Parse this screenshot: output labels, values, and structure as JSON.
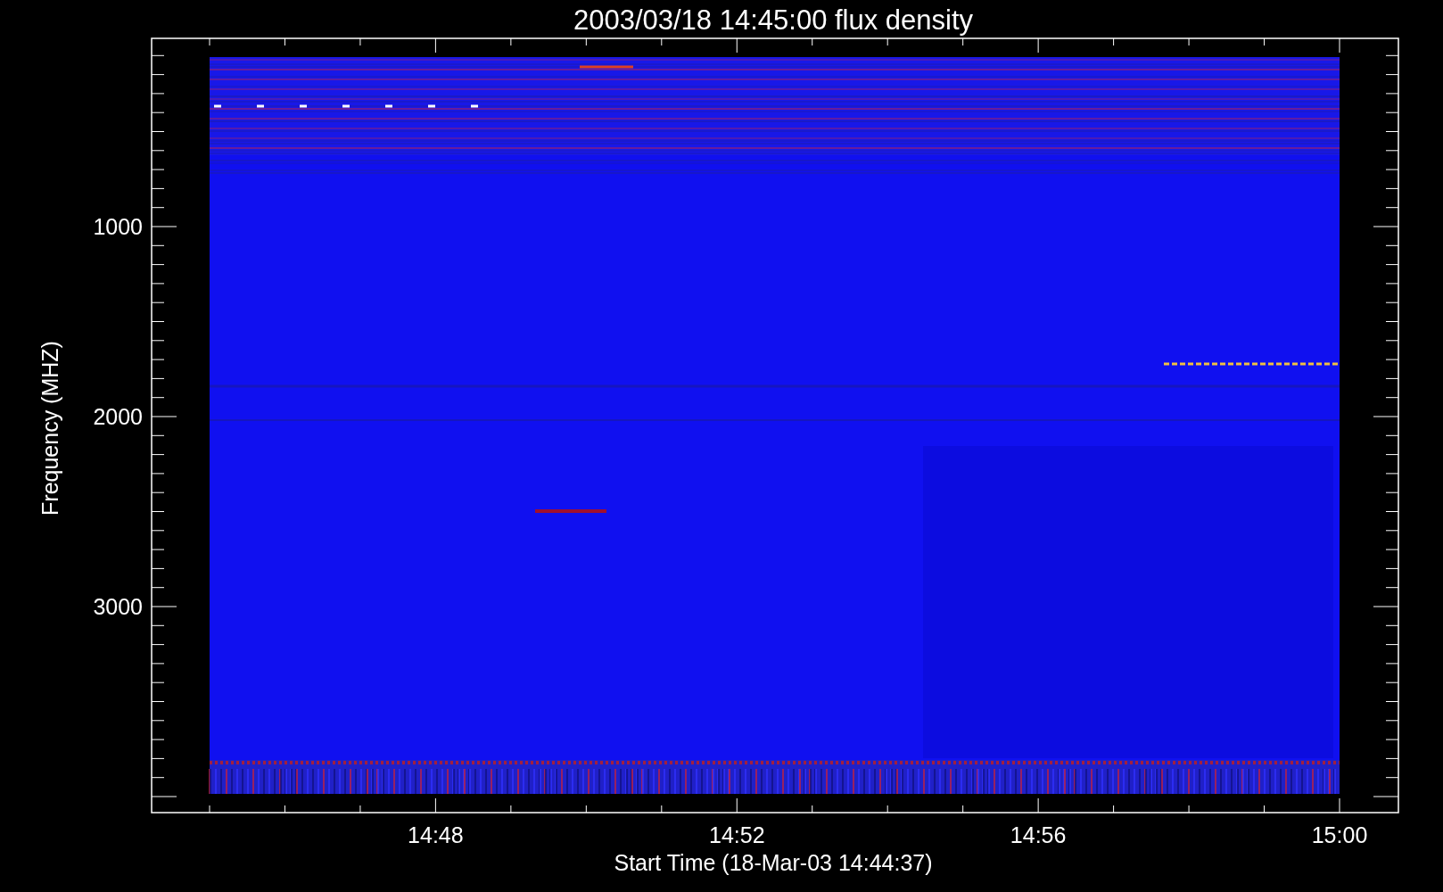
{
  "title": "2003/03/18 14:45:00 flux density",
  "y_axis": {
    "label": "Frequency (MHZ)",
    "ticks": [
      "1000",
      "2000",
      "3000"
    ]
  },
  "x_axis": {
    "label": "Start Time (18-Mar-03 14:44:37)",
    "ticks": [
      "14:48",
      "14:52",
      "14:56",
      "15:00"
    ]
  }
}
